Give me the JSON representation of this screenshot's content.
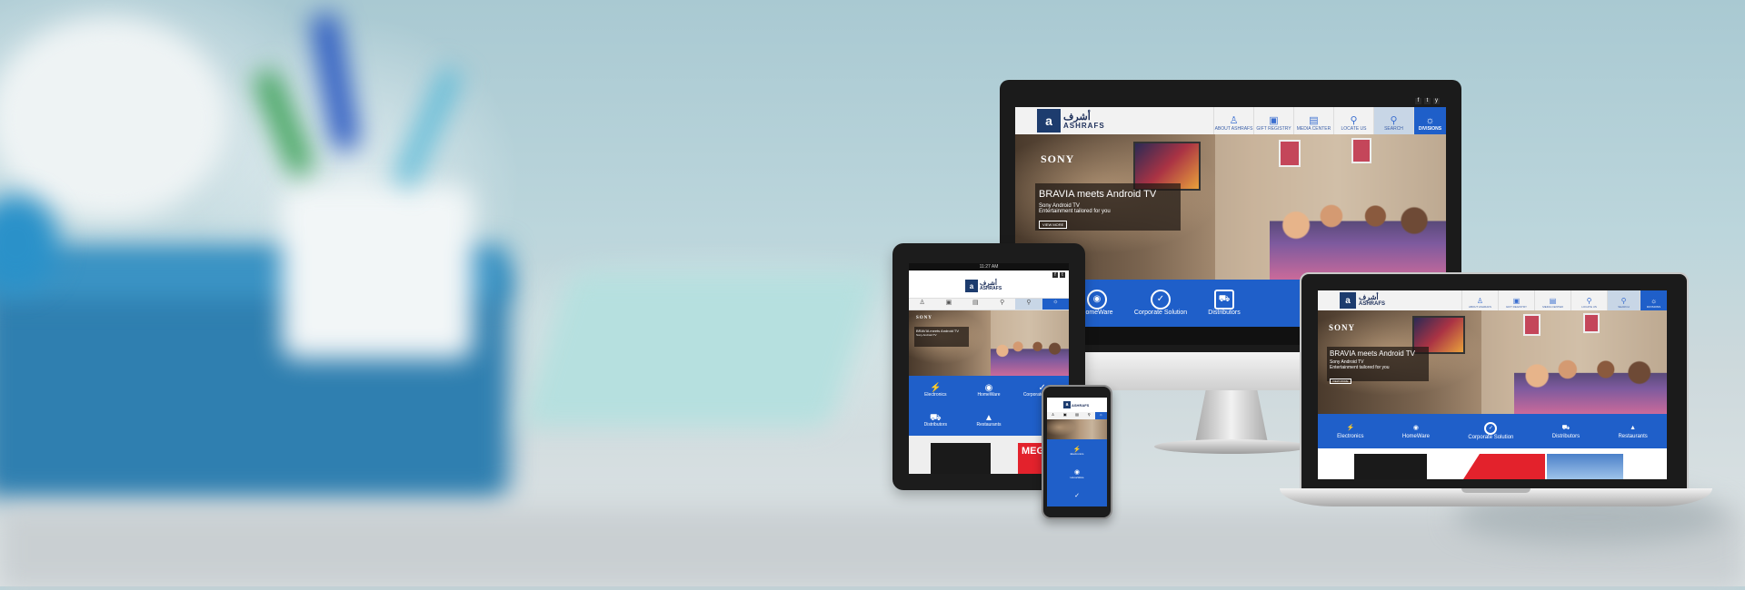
{
  "site": {
    "logo_arabic": "أشرف",
    "logo_name": "ASHRAFS",
    "nav": [
      {
        "icon": "person-icon",
        "label": "ABOUT ASHRAFS"
      },
      {
        "icon": "gift-icon",
        "label": "GIFT REGISTRY"
      },
      {
        "icon": "newspaper-icon",
        "label": "MEDIA CENTER"
      },
      {
        "icon": "location-pin-icon",
        "label": "LOCATE US"
      },
      {
        "icon": "search-icon",
        "label": "SEARCH"
      },
      {
        "icon": "network-icon",
        "label": "DIVISIONS"
      }
    ],
    "social": [
      "f",
      "t",
      "y"
    ],
    "hero": {
      "brand": "SONY",
      "headline": "BRAVIA meets Android TV",
      "subline1": "Sony Android TV",
      "subline2": "Entertainment tailored for you",
      "cta": "VIEW MORE"
    },
    "divisions": [
      {
        "icon": "plug-icon",
        "label": "Electronics"
      },
      {
        "icon": "dishes-icon",
        "label": "HomeWare"
      },
      {
        "icon": "checkmark-circle-icon",
        "label": "Corporate Solution"
      },
      {
        "icon": "truck-icon",
        "label": "Distributors"
      },
      {
        "icon": "cloche-icon",
        "label": "Restaurants"
      }
    ],
    "promo_text": "MEGA",
    "tablet_status_time": "11:27 AM"
  },
  "colors": {
    "brand_blue": "#1f5fc9",
    "logo_navy": "#1d3c6e",
    "promo_red": "#e3222c"
  }
}
